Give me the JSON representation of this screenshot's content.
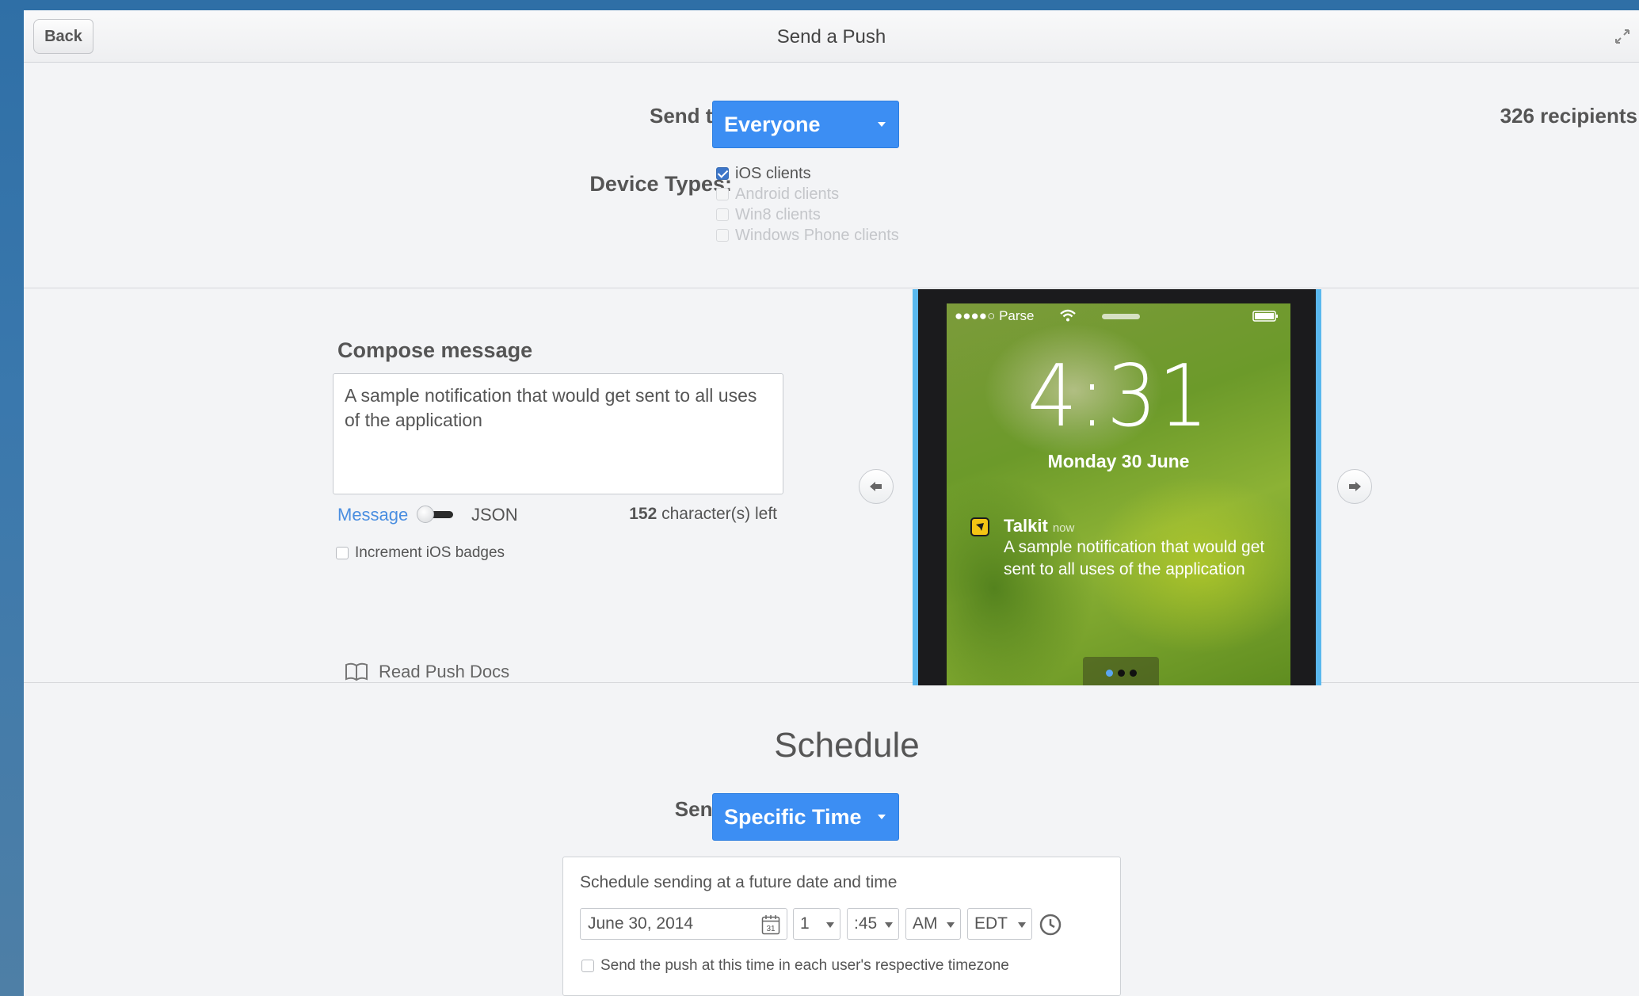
{
  "header": {
    "back_label": "Back",
    "title": "Send a Push"
  },
  "audience": {
    "send_to_label": "Send to:",
    "send_to_value": "Everyone",
    "recipients": "326 recipients",
    "device_types_label": "Device Types:",
    "device_types": [
      {
        "label": "iOS clients",
        "checked": true,
        "enabled": true
      },
      {
        "label": "Android clients",
        "checked": false,
        "enabled": false
      },
      {
        "label": "Win8 clients",
        "checked": false,
        "enabled": false
      },
      {
        "label": "Windows Phone clients",
        "checked": false,
        "enabled": false
      }
    ]
  },
  "compose": {
    "title": "Compose message",
    "message_text": "A sample notification that would get sent to all uses of the application",
    "mode_message": "Message",
    "mode_json": "JSON",
    "chars_left_count": "152",
    "chars_left_suffix": "character(s) left",
    "increment_badges_label": "Increment iOS badges",
    "docs_label": "Read Push Docs"
  },
  "preview": {
    "carrier": "●●●●○ Parse",
    "time": "4:31",
    "date": "Monday 30 June",
    "app_name": "Talkit",
    "notif_time": "now",
    "notif_text": "A sample notification that would get sent to all uses of the application",
    "page_count": 3,
    "active_page": 0
  },
  "schedule": {
    "title": "Schedule",
    "send_label": "Send:",
    "send_value": "Specific Time",
    "caption": "Schedule sending at a future date and time",
    "date": "June 30, 2014",
    "calendar_day": "31",
    "hour": "1",
    "minute": ":45",
    "ampm": "AM",
    "timezone": "EDT",
    "user_tz_label": "Send the push at this time in each user's respective timezone"
  },
  "colors": {
    "accent": "#3c8ef3",
    "link": "#4a8ee0",
    "phone_frame": "#5ab8ee"
  }
}
